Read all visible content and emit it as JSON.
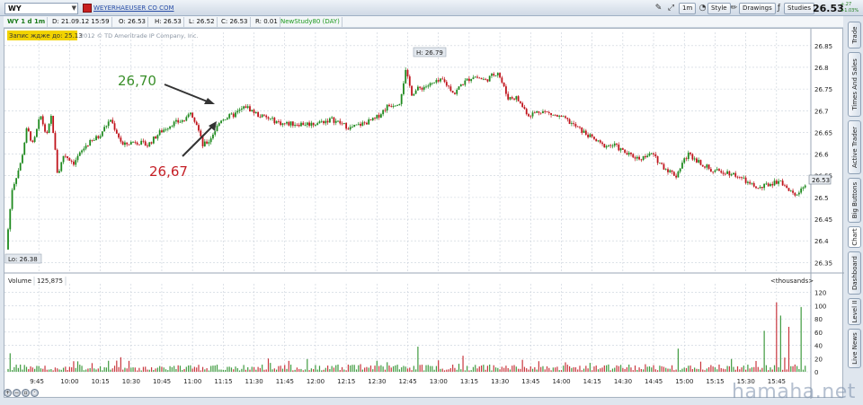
{
  "topbar": {
    "symbol": "WY",
    "company": "WEYERHAEUSER CO COM",
    "interval_btn": "1m",
    "style_btn": "Style",
    "drawings_btn": "Drawings",
    "studies_btn": "Studies",
    "last_price": "26.53",
    "change_up": "+.27",
    "change_pct": "+1.03%"
  },
  "subbar": {
    "title": "WY 1 d 1m",
    "date": "D: 21.09.12 15:59",
    "open": "O: 26.53",
    "high": "H: 26.53",
    "low": "L: 26.52",
    "close": "C: 26.53",
    "range": "R: 0.01",
    "study": "NewStudy80 (DAY)"
  },
  "overlay": {
    "delay_badge": "Запис ждже до: 25.13",
    "copyright": "2012 © TD Ameritrade IP Company, Inc.",
    "hi_label": "H: 26.79",
    "lo_label": "Lo: 26.38",
    "price_tag": "26.53",
    "annotation_upper": "26,70",
    "annotation_lower": "26,67",
    "volume_label": "Volume",
    "volume_value": "125,875",
    "volume_units": "<thousands>"
  },
  "side_tabs": [
    "Trade",
    "Times And Sales",
    "Active Trader",
    "Big Buttons",
    "Chart",
    "Dashboard",
    "Level II",
    "Live News"
  ],
  "watermark": "hamaha.net",
  "colors": {
    "up": "#1f8a1f",
    "down": "#c0141c",
    "grid": "#c8d0da",
    "annot_up": "#3a8f2a",
    "annot_down": "#c51f26"
  },
  "chart_data": [
    {
      "type": "candlestick",
      "title": "WY 1 d 1m",
      "x_ticks": [
        "9:45",
        "10:00",
        "10:15",
        "10:30",
        "10:45",
        "11:00",
        "11:15",
        "11:30",
        "11:45",
        "12:00",
        "12:15",
        "12:30",
        "12:45",
        "13:00",
        "13:15",
        "13:30",
        "13:45",
        "14:00",
        "14:15",
        "14:30",
        "14:45",
        "15:00",
        "15:15",
        "15:30",
        "15:45"
      ],
      "y_ticks": [
        "26.85",
        "26.8",
        "26.75",
        "26.7",
        "26.65",
        "26.6",
        "26.55",
        "26.5",
        "26.45",
        "26.4",
        "26.35"
      ],
      "ylim": [
        26.33,
        26.86
      ],
      "x_minutes": [
        9.5,
        16.0
      ],
      "price_path": [
        [
          9.5,
          26.38
        ],
        [
          9.55,
          26.52
        ],
        [
          9.62,
          26.58
        ],
        [
          9.67,
          26.66
        ],
        [
          9.72,
          26.62
        ],
        [
          9.78,
          26.69
        ],
        [
          9.83,
          26.64
        ],
        [
          9.87,
          26.69
        ],
        [
          9.92,
          26.55
        ],
        [
          9.97,
          26.6
        ],
        [
          10.05,
          26.58
        ],
        [
          10.15,
          26.62
        ],
        [
          10.25,
          26.64
        ],
        [
          10.35,
          26.68
        ],
        [
          10.45,
          26.62
        ],
        [
          10.55,
          26.63
        ],
        [
          10.65,
          26.62
        ],
        [
          10.75,
          26.65
        ],
        [
          10.85,
          26.67
        ],
        [
          10.97,
          26.68
        ],
        [
          11.0,
          26.7
        ],
        [
          11.05,
          26.67
        ],
        [
          11.1,
          26.62
        ],
        [
          11.15,
          26.63
        ],
        [
          11.25,
          26.68
        ],
        [
          11.35,
          26.69
        ],
        [
          11.45,
          26.71
        ],
        [
          11.55,
          26.69
        ],
        [
          11.65,
          26.68
        ],
        [
          11.75,
          26.67
        ],
        [
          11.85,
          26.67
        ],
        [
          12.0,
          26.67
        ],
        [
          12.15,
          26.68
        ],
        [
          12.3,
          26.66
        ],
        [
          12.4,
          26.67
        ],
        [
          12.5,
          26.68
        ],
        [
          12.6,
          26.71
        ],
        [
          12.7,
          26.72
        ],
        [
          12.75,
          26.79
        ],
        [
          12.8,
          26.74
        ],
        [
          12.85,
          26.75
        ],
        [
          12.95,
          26.76
        ],
        [
          13.05,
          26.77
        ],
        [
          13.15,
          26.74
        ],
        [
          13.2,
          26.76
        ],
        [
          13.3,
          26.78
        ],
        [
          13.4,
          26.77
        ],
        [
          13.5,
          26.79
        ],
        [
          13.58,
          26.73
        ],
        [
          13.65,
          26.73
        ],
        [
          13.75,
          26.69
        ],
        [
          13.85,
          26.7
        ],
        [
          13.95,
          26.69
        ],
        [
          14.05,
          26.68
        ],
        [
          14.15,
          26.66
        ],
        [
          14.25,
          26.64
        ],
        [
          14.35,
          26.62
        ],
        [
          14.45,
          26.62
        ],
        [
          14.55,
          26.6
        ],
        [
          14.65,
          26.59
        ],
        [
          14.75,
          26.6
        ],
        [
          14.85,
          26.57
        ],
        [
          14.95,
          26.55
        ],
        [
          15.0,
          26.58
        ],
        [
          15.05,
          26.6
        ],
        [
          15.15,
          26.58
        ],
        [
          15.25,
          26.56
        ],
        [
          15.35,
          26.56
        ],
        [
          15.45,
          26.55
        ],
        [
          15.55,
          26.53
        ],
        [
          15.62,
          26.52
        ],
        [
          15.7,
          26.53
        ],
        [
          15.8,
          26.54
        ],
        [
          15.88,
          26.51
        ],
        [
          15.93,
          26.51
        ],
        [
          16.0,
          26.53
        ]
      ]
    },
    {
      "type": "bar",
      "title": "Volume",
      "y_ticks": [
        "120",
        "100",
        "80",
        "60",
        "40",
        "20",
        "0"
      ],
      "ylim": [
        0,
        125
      ],
      "units": "<thousands>",
      "spikes": [
        [
          9.52,
          28
        ],
        [
          10.42,
          22
        ],
        [
          11.62,
          20
        ],
        [
          12.83,
          38
        ],
        [
          14.95,
          35
        ],
        [
          15.65,
          62
        ],
        [
          15.75,
          105
        ],
        [
          15.78,
          85
        ],
        [
          15.85,
          68
        ],
        [
          15.95,
          98
        ]
      ]
    }
  ]
}
